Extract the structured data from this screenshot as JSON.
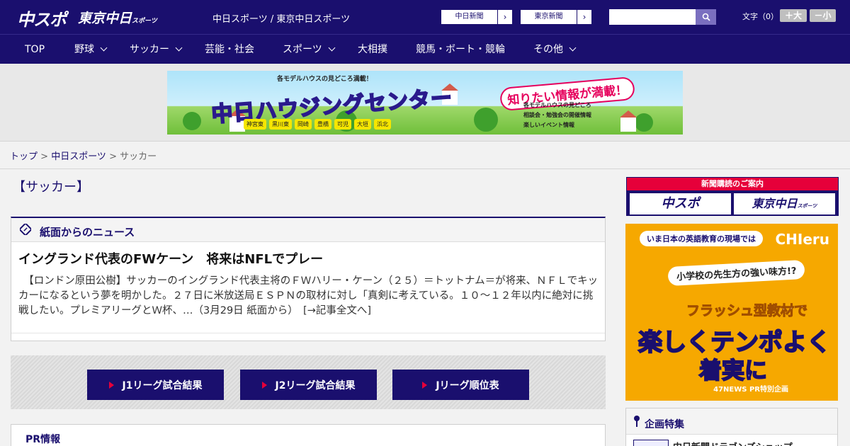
{
  "header": {
    "logo_main": "中スポ",
    "logo_sub": "東京中日",
    "logo_sub_small": "スポーツ",
    "site_title": "中日スポーツ / 東京中日スポーツ",
    "paper_links": [
      {
        "label": "中日新聞"
      },
      {
        "label": "東京新聞"
      }
    ],
    "search_placeholder": "",
    "font_size_label": "文字（0）",
    "font_bigger": "＋大",
    "font_smaller": "－小"
  },
  "nav": {
    "items": [
      {
        "label": "TOP",
        "dropdown": false
      },
      {
        "label": "野球",
        "dropdown": true
      },
      {
        "label": "サッカー",
        "dropdown": true
      },
      {
        "label": "芸能・社会",
        "dropdown": false
      },
      {
        "label": "スポーツ",
        "dropdown": true
      },
      {
        "label": "大相撲",
        "dropdown": false
      },
      {
        "label": "競馬・ボート・競輪",
        "dropdown": false
      },
      {
        "label": "その他",
        "dropdown": true
      }
    ]
  },
  "banner": {
    "top_text": "各モデルハウスの見どころ満載！",
    "main_text": "中日ハウジングセンター",
    "right_text": "知りたい情報が満載！",
    "tags": [
      "神宮東",
      "黒川東",
      "岡崎",
      "豊橋",
      "可児",
      "大垣",
      "浜北"
    ],
    "bullets": [
      "各モデルハウスの見どころ",
      "相談会・勉強会の開催情報",
      "楽しいイベント情報"
    ]
  },
  "breadcrumb": {
    "home": "トップ",
    "section": "中日スポーツ",
    "current": "サッカー",
    "sep": " > "
  },
  "page_title": "【サッカー】",
  "news": {
    "heading": "紙面からのニュース",
    "title": "イングランド代表のFWケーン　将来はNFLでプレー",
    "body": "　【ロンドン原田公樹】サッカーのイングランド代表主将のＦＷハリー・ケーン（２５）＝トットナム＝が将来、ＮＦＬでキッカーになるという夢を明かした。２７日に米放送局ＥＳＰＮの取材に対し「真剣に考えている。１０～１２年以内に絶対に挑戦したい。プレミアリーグとＷ杯、…（3月29日 紙面から）",
    "more_link": "[→記事全文へ]"
  },
  "jleague": {
    "buttons": [
      {
        "label": "J1リーグ試合結果"
      },
      {
        "label": "J2リーグ試合結果"
      },
      {
        "label": "Jリーグ順位表"
      }
    ]
  },
  "pr": {
    "heading": "PR情報"
  },
  "sidebar": {
    "subscribe": {
      "heading": "新聞購読のご案内",
      "logo1": "中スポ",
      "logo2": "東京中日",
      "logo2_small": "スポーツ"
    },
    "ad": {
      "bubble": "いま日本の英語教育の現場では",
      "brand": "CHIeru",
      "line2": "小学校の先生方の強い味方!?",
      "line3": "フラッシュ型教材で",
      "line4": "楽しくテンポよく",
      "line5": "着実に",
      "footer": "47NEWS PR特別企画"
    },
    "kikaku": {
      "heading": "企画特集",
      "item": "中日新聞ドラゴンズショップ"
    }
  },
  "colors": {
    "brand_navy": "#1a0f6e",
    "accent_red": "#e6003a"
  }
}
